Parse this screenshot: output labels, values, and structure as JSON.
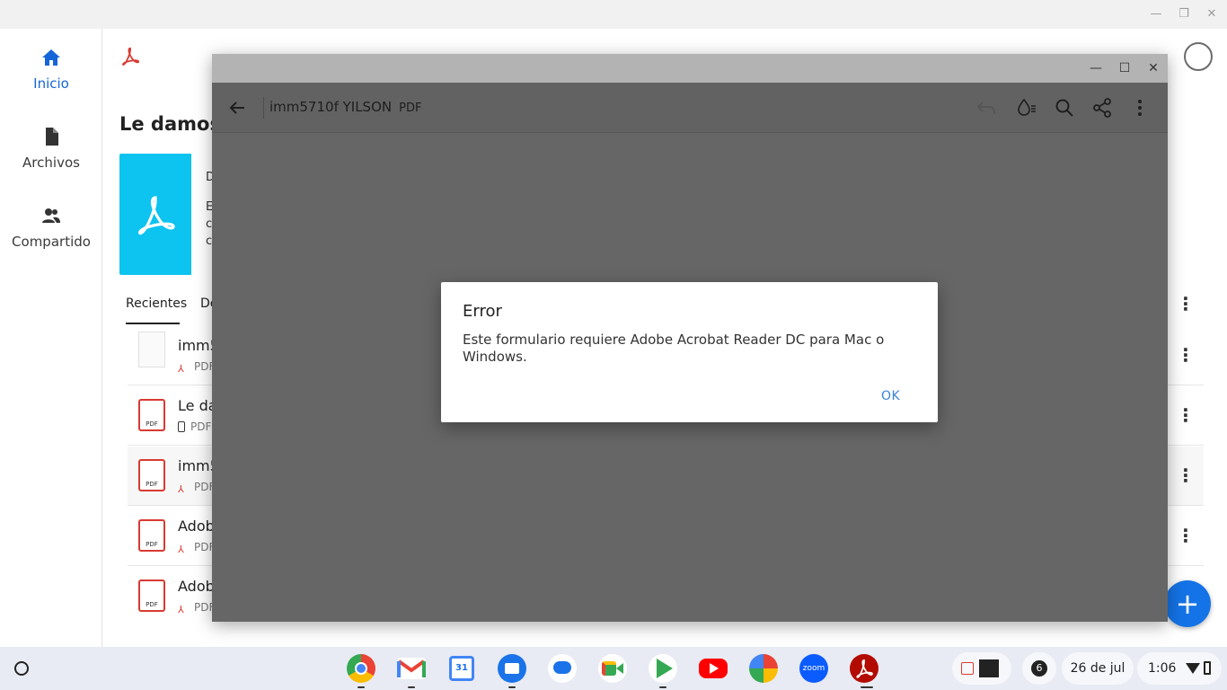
{
  "nav": {
    "items": [
      {
        "label": "Inicio"
      },
      {
        "label": "Archivos"
      },
      {
        "label": "Compartido"
      }
    ]
  },
  "home": {
    "hero_title": "Le damos",
    "hero_snip_title": "D",
    "hero_snip_lines": [
      "E",
      "c",
      "c"
    ],
    "tabs": {
      "recent": "Recientes",
      "other": "De"
    },
    "rows": [
      {
        "title": "imm5",
        "sub": "PDF"
      },
      {
        "title": "Le da",
        "sub": "PDF"
      },
      {
        "title": "imm5",
        "sub": "PDF"
      },
      {
        "title": "Adobe",
        "sub": "PDF"
      },
      {
        "title": "Adobe",
        "sub": "PDF"
      }
    ],
    "fab_label": "+",
    "pdf_badge": "PDF"
  },
  "viewer": {
    "title": "imm5710f YILSON",
    "type": "PDF"
  },
  "dialog": {
    "title": "Error",
    "message": "Este formulario requiere Adobe Acrobat Reader DC para Mac o Windows.",
    "ok": "OK"
  },
  "shelf": {
    "notification_count": "6",
    "date": "26 de jul",
    "time": "1:06",
    "zoom_label": "zoom",
    "calendar_day": "31"
  },
  "colors": {
    "accent": "#1665d8",
    "acrobat_red": "#d73a32",
    "fab": "#1473e6",
    "hero_card": "#0dc3ef"
  }
}
